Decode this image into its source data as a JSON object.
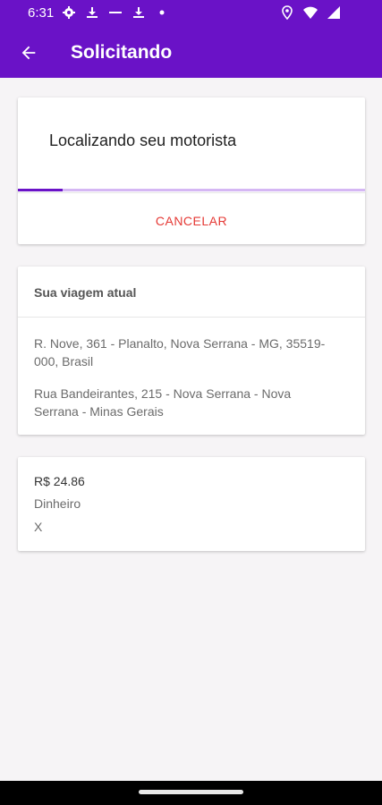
{
  "status_bar": {
    "time": "6:31",
    "left_icons": [
      "gear-icon",
      "download-icon",
      "minus-icon",
      "download-icon",
      "dot-icon"
    ],
    "right_icons": [
      "location-icon",
      "wifi-icon",
      "signal-icon"
    ]
  },
  "app_bar": {
    "title": "Solicitando",
    "back_icon": "arrow-left-icon",
    "background": "#6a12c7"
  },
  "search_card": {
    "message": "Localizando seu motorista",
    "progress_fraction": 0.13,
    "cancel_label": "CANCELAR",
    "cancel_color": "#e53935"
  },
  "trip_card": {
    "heading": "Sua viagem atual",
    "origin": "R. Nove, 361 - Planalto, Nova Serrana - MG, 35519-000, Brasil",
    "destination": "Rua Bandeirantes, 215 - Nova Serrana - Nova Serrana - Minas Gerais"
  },
  "payment_card": {
    "price": "R$ 24.86",
    "method": "Dinheiro",
    "extra": "X"
  }
}
